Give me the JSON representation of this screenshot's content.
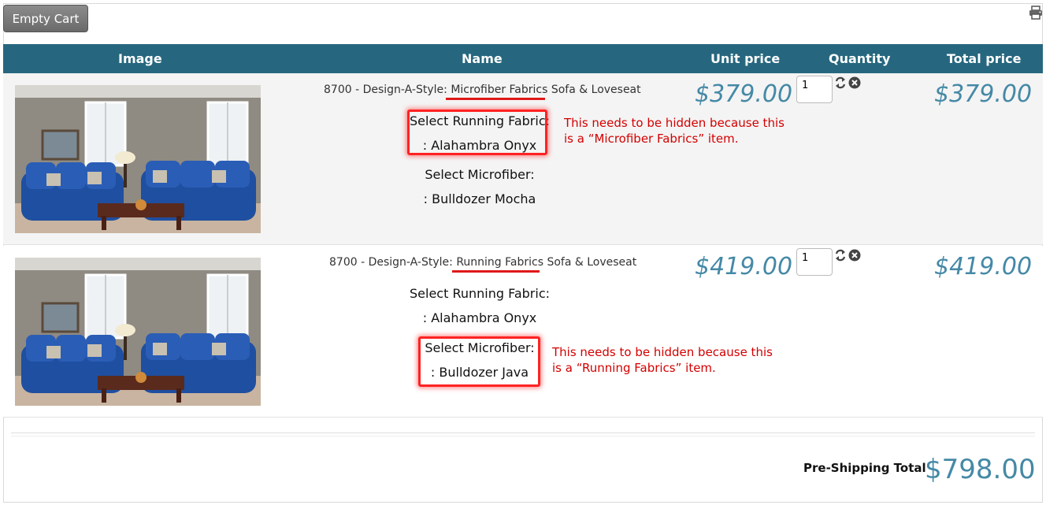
{
  "toolbar": {
    "empty_cart_label": "Empty Cart"
  },
  "table": {
    "headers": {
      "image": "Image",
      "name": "Name",
      "unit_price": "Unit price",
      "quantity": "Quantity",
      "total_price": "Total price"
    }
  },
  "items": [
    {
      "name_prefix": "8700 - Design-A-Style: ",
      "name_highlight": "Microfiber Fabrics",
      "name_suffix": " Sofa & Loveseat",
      "option1_label": "Select Running Fabric:",
      "option1_value": ": Alahambra Onyx",
      "option2_label": "Select Microfiber:",
      "option2_value": ": Bulldozer Mocha",
      "note_line1": "This needs to be hidden because this",
      "note_line2": "is a “Microfiber Fabrics” item.",
      "unit_price": "$379.00",
      "quantity": "1",
      "total_price": "$379.00"
    },
    {
      "name_prefix": "8700 - Design-A-Style: ",
      "name_highlight": "Running Fabrics",
      "name_suffix": " Sofa & Loveseat",
      "option1_label": "Select Running Fabric:",
      "option1_value": ": Alahambra Onyx",
      "option2_label": "Select Microfiber:",
      "option2_value": ": Bulldozer Java",
      "note_line1": "This needs to be hidden because this",
      "note_line2": "is a “Running Fabrics” item.",
      "unit_price": "$419.00",
      "quantity": "1",
      "total_price": "$419.00"
    }
  ],
  "summary": {
    "label": "Pre-Shipping Total",
    "value": "$798.00"
  },
  "icons": {
    "print": "print-icon",
    "update": "refresh-icon",
    "remove": "remove-icon"
  },
  "colors": {
    "header_bg": "#26677f",
    "price": "#4589a6",
    "annotation": "#d40000"
  }
}
